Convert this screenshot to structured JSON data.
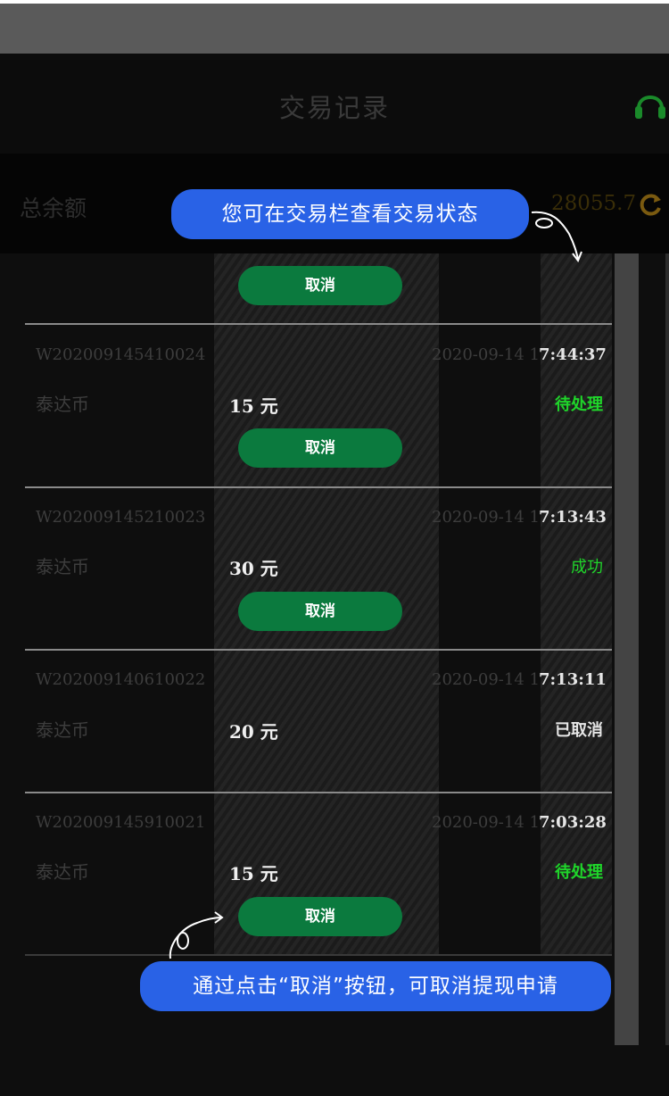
{
  "header": {
    "title": "交易记录"
  },
  "balance": {
    "label": "总余额",
    "amount": "28055.7"
  },
  "first_row": {
    "cancel_label": "取消"
  },
  "records": [
    {
      "id": "W202009145410024",
      "date": "2020-09-14 1",
      "time": "7:44:37",
      "currency": "泰达币",
      "amount": "15 元",
      "status": "待处理",
      "status_color": "#1fd52a",
      "cancel_label": "取消"
    },
    {
      "id": "W202009145210023",
      "date": "2020-09-14 1",
      "time": "7:13:43",
      "currency": "泰达币",
      "amount": "30 元",
      "status": "成功",
      "status_color": "#1fd52a",
      "cancel_label": "取消"
    },
    {
      "id": "W202009140610022",
      "date": "2020-09-14 1",
      "time": "7:13:11",
      "currency": "泰达币",
      "amount": "20 元",
      "status": "已取消",
      "status_color": "#e6e6e6"
    },
    {
      "id": "W202009145910021",
      "date": "2020-09-14 1",
      "time": "7:03:28",
      "currency": "泰达币",
      "amount": "15 元",
      "status": "待处理",
      "status_color": "#1fd52a",
      "cancel_label": "取消"
    }
  ],
  "tooltips": {
    "status_tip": "您可在交易栏查看交易状态",
    "cancel_tip": "通过点击“取消”按钮，可取消提现申请"
  },
  "colors": {
    "accent_green": "#0b7a3e",
    "tip_blue": "#2962e6",
    "success_green": "#1fd52a"
  },
  "icons": {
    "support": "headset-icon",
    "refresh": "refresh-icon"
  }
}
